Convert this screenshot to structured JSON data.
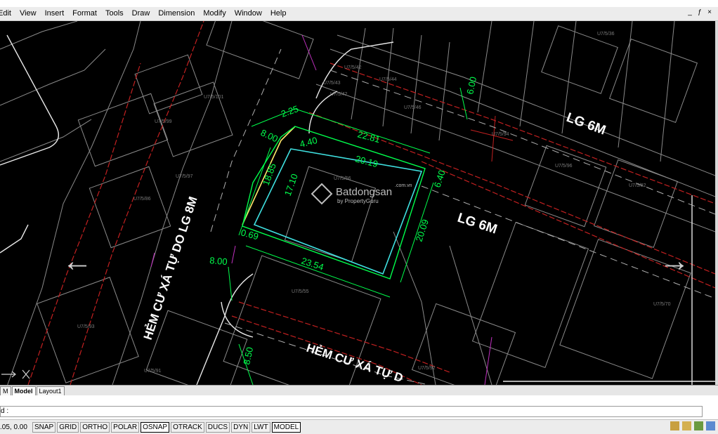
{
  "menu": [
    "Edit",
    "View",
    "Insert",
    "Format",
    "Tools",
    "Draw",
    "Dimension",
    "Modify",
    "Window",
    "Help"
  ],
  "window_controls": [
    "_",
    "ƒ",
    "×"
  ],
  "drawing": {
    "road_labels": {
      "lg6m_top": "LG 6M",
      "lg6m_mid": "LG 6M",
      "hem8m": "HẺM CƯ XÁ TỰ DO LG 8M",
      "hem_bottom": "HẺM CƯ XÁ TỰ D"
    },
    "dimensions": {
      "d225": "2.25",
      "d800a": "8.00",
      "d440": "4.40",
      "d2281": "22.81",
      "d2019": "20.19",
      "d1885": "18.85",
      "d1710": "17.10",
      "d640": "6.40",
      "d2009": "20.09",
      "d2354": "23.54",
      "d069": "0.69",
      "d800b": "8.00",
      "d600": "6.00",
      "d850": "8.50"
    },
    "lot_labels": [
      "U7/5/36",
      "U7/5/42",
      "U7/5/43",
      "U7/5/44",
      "U7/5/42",
      "U7/5/46",
      "U7/5/101",
      "U7/5/99",
      "U7/5/94",
      "U7/5/96",
      "U7/5/97",
      "U7/5/56",
      "U7/5/82",
      "U7/5/93",
      "U7/5/55",
      "U7/5/70",
      "U7/5/91",
      "U7/5/92",
      "U7/5/86"
    ]
  },
  "watermark": {
    "brand": "Batdongsan",
    "domain": ".com.vn",
    "by": "by PropertyGuru"
  },
  "nav": {
    "left": "←",
    "right": "→"
  },
  "tabs": [
    "M",
    "Model",
    "Layout1"
  ],
  "command": {
    "prompt": "d :"
  },
  "status": {
    "coords": ".05, 0.00",
    "buttons": [
      "SNAP",
      "GRID",
      "ORTHO",
      "POLAR",
      "OSNAP",
      "OTRACK",
      "DUCS",
      "DYN",
      "LWT",
      "MODEL"
    ]
  },
  "colors": {
    "bg": "#000000",
    "green": "#00ff4c",
    "cyan": "#3fe0e0",
    "yellow": "#ffe86b",
    "red": "#c22020",
    "white": "#ffffff",
    "magenta": "#c030c0"
  }
}
